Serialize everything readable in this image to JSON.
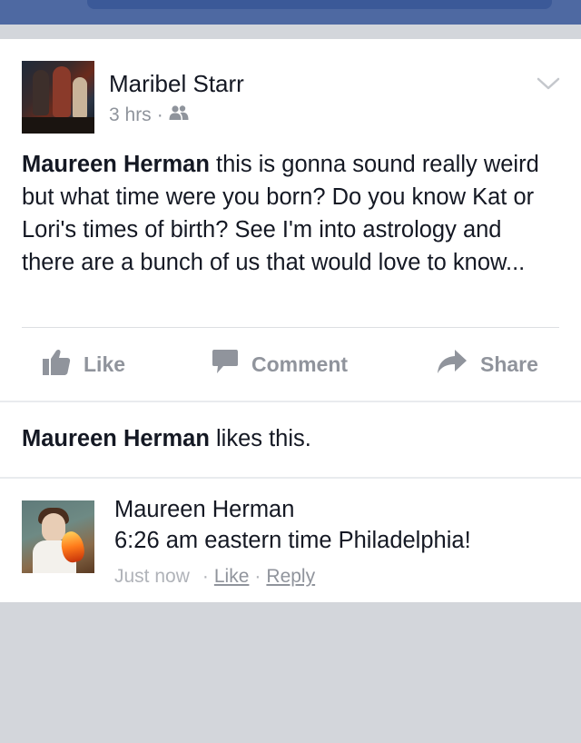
{
  "post": {
    "author": "Maribel Starr",
    "time": "3 hrs",
    "separator": "·",
    "audience_icon": "friends-icon",
    "body_mention": "Maureen Herman",
    "body_text": " this is gonna sound really weird but what time were you born? Do you know Kat or Lori's times of birth? See I'm into astrology and there are a bunch of us that would love to know..."
  },
  "actions": {
    "like_label": "Like",
    "comment_label": "Comment",
    "share_label": "Share"
  },
  "likes": {
    "mention": "Maureen Herman",
    "text": " likes this."
  },
  "comment": {
    "author": "Maureen Herman",
    "text": "6:26 am eastern time Philadelphia!",
    "time": "Just now",
    "sep": "·",
    "like_label": "Like",
    "reply_label": "Reply"
  },
  "colors": {
    "header": "#4e69a2",
    "background": "#d3d6db",
    "action_gray": "#90949c"
  }
}
